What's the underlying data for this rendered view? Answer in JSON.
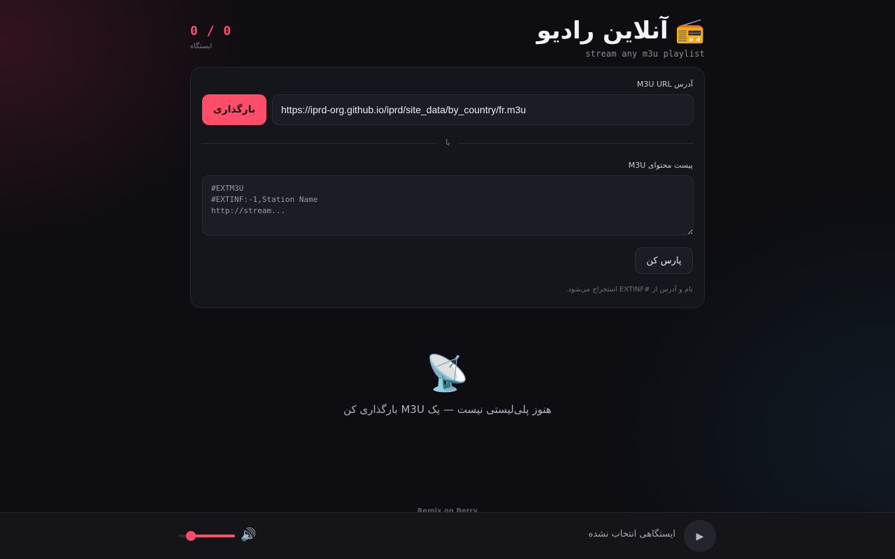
{
  "header": {
    "title": "آنلاین رادیو",
    "title_icon": "📻",
    "subtitle": "stream any m3u playlist",
    "counter": "0 / 0",
    "counter_label": "ایستگاه"
  },
  "form": {
    "url_label": "آدرس M3U URL",
    "url_value": "https://iprd-org.github.io/iprd/site_data/by_country/fr.m3u",
    "load_button": "بارگذاری",
    "or_text": "یا",
    "paste_label": "پیست محتوای M3U",
    "paste_placeholder": "#EXTM3U\n#EXTINF:-1,Station Name\nhttp://stream...",
    "parse_button": "پارس کن",
    "hint": "نام و آدرس از #EXTINF استخراج می‌شود."
  },
  "empty_state": {
    "icon": "📡",
    "text": "هنوز پلی‌لیستی نیست — یک M3U بارگذاری کن"
  },
  "remix_link": "Remix on Berry",
  "player": {
    "play_icon": "▶",
    "now_playing": "ایستگاهی انتخاب نشده",
    "volume_icon": "🔊",
    "volume_level": 0.8,
    "accent_color": "#ff4d6a"
  }
}
